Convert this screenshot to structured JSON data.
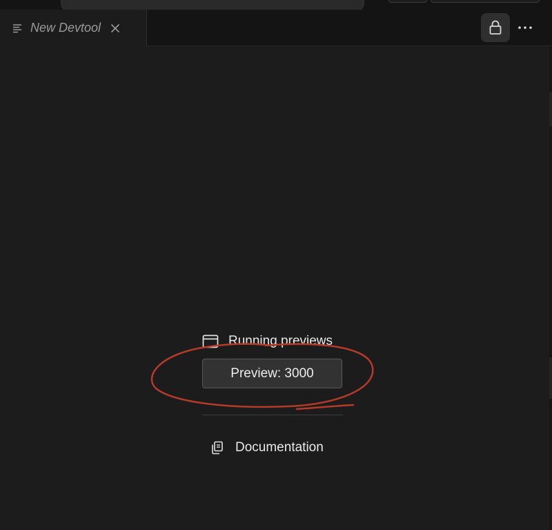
{
  "tab": {
    "title": "New Devtool",
    "icon": "list-lines-icon",
    "close_icon": "close-icon"
  },
  "toolbar": {
    "lock_icon": "lock-icon",
    "more_icon": "more-horizontal-icon"
  },
  "previews": {
    "heading": "Running previews",
    "heading_icon": "browser-window-icon",
    "items": [
      {
        "label": "Preview: 3000"
      }
    ]
  },
  "documentation": {
    "label": "Documentation",
    "icon": "copy-documents-icon"
  },
  "colors": {
    "background": "#1c1c1c",
    "tabbar": "#141414",
    "annotation": "#b63a2a",
    "button": "#323232"
  }
}
